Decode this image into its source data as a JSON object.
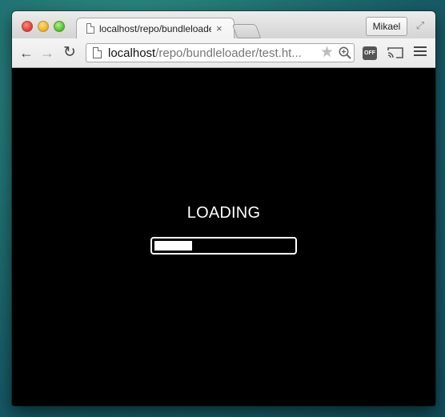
{
  "browser": {
    "tab": {
      "title": "localhost/repo/bundleloader/test.html",
      "close_glyph": "×"
    },
    "profile": "Mikael",
    "address": {
      "host": "localhost",
      "path": "/repo/bundleloader/test.ht..."
    },
    "extension_badge": "OFF"
  },
  "page": {
    "loading_text": "LOADING",
    "progress_fraction": 0.27
  },
  "colors": {
    "page_background": "#000000",
    "progress_color": "#ffffff"
  }
}
